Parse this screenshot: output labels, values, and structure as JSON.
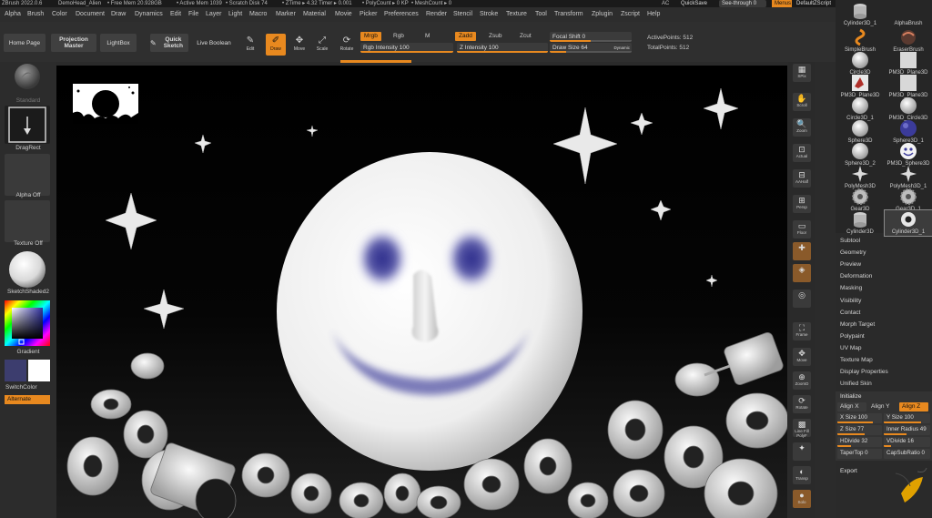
{
  "titlebar": {
    "app_title": "ZBrush 2022.0.6",
    "project": "DemoHead_Alien",
    "free_mem": "• Free Mem 20.928GB",
    "active_mem": "• Active Mem 1039",
    "scratch": "• Scratch Disk 74",
    "ztime": "• ZTime ▸ 4.32 Timer ▸ 0.001",
    "polycount": "• PolyCount ▸ 0 KP",
    "meshcount": "• MeshCount ▸ 0",
    "ac": "AC",
    "quicksave": "QuickSave",
    "see_through": "See-through 0",
    "menus": "Menus",
    "default_zscript": "DefaultZScript"
  },
  "menubar": [
    "Alpha",
    "Brush",
    "Color",
    "Document",
    "Draw",
    "Dynamics",
    "Edit",
    "File",
    "Layer",
    "Light",
    "Macro",
    "Marker",
    "Material",
    "Movie",
    "Picker",
    "Preferences",
    "Render",
    "Stencil",
    "Stroke",
    "Texture",
    "Tool",
    "Transform",
    "Zplugin",
    "Zscript",
    "Help"
  ],
  "toolbar": {
    "home_page": "Home Page",
    "projection_master": "Projection Master",
    "lightbox": "LightBox",
    "quick_sketch": "Quick Sketch",
    "live_boolean": "Live Boolean",
    "tools": [
      {
        "label": "Edit",
        "glyph": "✎"
      },
      {
        "label": "Draw",
        "glyph": "✐"
      },
      {
        "label": "Move",
        "glyph": "✥"
      },
      {
        "label": "Scale",
        "glyph": "⤢"
      },
      {
        "label": "Rotate",
        "glyph": "⟳"
      }
    ],
    "mrgb": "Mrgb",
    "rgb": "Rgb",
    "m": "M",
    "rgb_intensity": "Rgb Intensity 100",
    "zadd": "Zadd",
    "zsub": "Zsub",
    "zcut": "Zcut",
    "z_intensity": "Z Intensity 100",
    "focal_shift": "Focal Shift 0",
    "draw_size": "Draw Size 64",
    "dynamic": "Dynamic",
    "active_points": "ActivePoints: 512",
    "total_points": "TotalPoints: 512"
  },
  "leftshelf": {
    "standard": "Standard",
    "dragrect": "DragRect",
    "alpha_off": "Alpha Off",
    "texture_off": "Texture Off",
    "material": "SketchShaded2",
    "gradient": "Gradient",
    "switchcolor": "SwitchColor",
    "alternate": "Alternate"
  },
  "rightstrip": [
    {
      "label": "SPix",
      "glyph": "▦"
    },
    {
      "label": "Scroll",
      "glyph": "✋"
    },
    {
      "label": "Zoom",
      "glyph": "🔍"
    },
    {
      "label": "Actual",
      "glyph": "⊡"
    },
    {
      "label": "AAHalf",
      "glyph": "⊟"
    },
    {
      "label": "Persp",
      "glyph": "⊞"
    },
    {
      "label": "Floor",
      "glyph": "▭"
    },
    {
      "label": "",
      "glyph": "✚"
    },
    {
      "label": "",
      "glyph": "◈"
    },
    {
      "label": "",
      "glyph": "◎"
    },
    {
      "label": "Frame",
      "glyph": "⛶"
    },
    {
      "label": "Move",
      "glyph": "✥"
    },
    {
      "label": "ZoomD",
      "glyph": "⊕"
    },
    {
      "label": "Rotate",
      "glyph": "⟳"
    },
    {
      "label": "Line Fill PolyF",
      "glyph": "▩"
    },
    {
      "label": "",
      "glyph": "✦"
    },
    {
      "label": "Transp",
      "glyph": "◐"
    },
    {
      "label": "Solo",
      "glyph": "●"
    }
  ],
  "subtools": [
    {
      "label": "Cylinder3D_1",
      "shape": "cylinder"
    },
    {
      "label": "AlphaBrush",
      "shape": "none"
    },
    {
      "label": "SimpleBrush",
      "shape": "swirl"
    },
    {
      "label": "EraserBrush",
      "shape": "eraser"
    },
    {
      "label": "Circle3D",
      "shape": "sphere"
    },
    {
      "label": "PM3D_Plane3D",
      "shape": "square"
    },
    {
      "label": "PM3D_Plane3D",
      "shape": "red"
    },
    {
      "label": "PM3D_Plane3D",
      "shape": "square"
    },
    {
      "label": "Circle3D_1",
      "shape": "sphere"
    },
    {
      "label": "PM3D_Circle3D",
      "shape": "sphere"
    },
    {
      "label": "Sphere3D",
      "shape": "sphere"
    },
    {
      "label": "Sphere3D_1",
      "shape": "blue"
    },
    {
      "label": "Sphere3D_2",
      "shape": "sphere"
    },
    {
      "label": "PM3D_Sphere3D",
      "shape": "smiley"
    },
    {
      "label": "PolyMesh3D",
      "shape": "star"
    },
    {
      "label": "PolyMesh3D_1",
      "shape": "star"
    },
    {
      "label": "Gear3D",
      "shape": "gear"
    },
    {
      "label": "Gear3D_1",
      "shape": "gear"
    },
    {
      "label": "Cylinder3D",
      "shape": "cylinder"
    },
    {
      "label": "Cylinder3D_1",
      "shape": "ring"
    }
  ],
  "panel_items": [
    "Subtool",
    "Geometry",
    "Preview",
    "Deformation",
    "Masking",
    "Visibility",
    "Contact",
    "Morph Target",
    "Polypaint",
    "UV Map",
    "Texture Map",
    "Display Properties",
    "Unified Skin"
  ],
  "initialize": {
    "title": "Initialize",
    "align_x": "Align X",
    "align_y": "Align Y",
    "align_z": "Align Z",
    "x_size": "X Size 100",
    "y_size": "Y Size 100",
    "z_size": "Z Size 77",
    "inner_radius": "Inner Radius 49",
    "hdivide": "HDivide 32",
    "vdivide": "VDivide 16",
    "tapertop": "TaperTop 0",
    "capsubratio": "CapSubRatio 0"
  },
  "export": "Export",
  "colors": {
    "accent": "#e8891f",
    "panel": "#2a2a2a",
    "canvas": "#000000"
  }
}
